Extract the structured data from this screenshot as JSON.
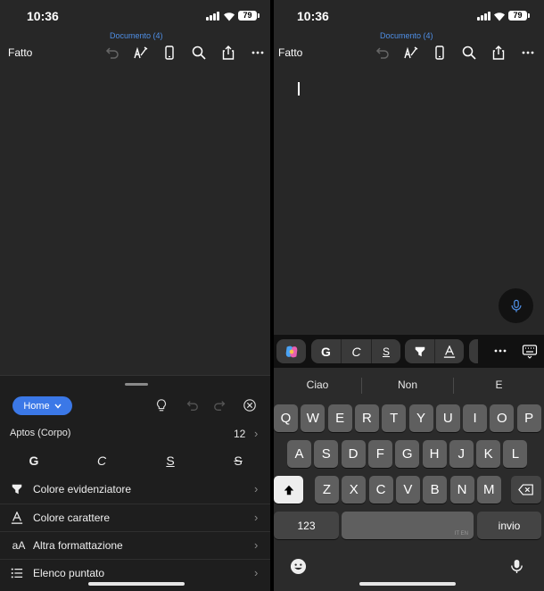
{
  "left": {
    "status": {
      "time": "10:36",
      "battery": "79"
    },
    "doc_title": "Documento (4)",
    "done_label": "Fatto",
    "sheet": {
      "tab_label": "Home",
      "font_name": "Aptos (Corpo)",
      "font_size": "12",
      "format_buttons": [
        "G",
        "C",
        "S",
        "S"
      ],
      "menu_items": [
        {
          "label": "Colore evidenziatore",
          "icon": "highlighter-icon"
        },
        {
          "label": "Colore carattere",
          "icon": "font-color-icon"
        },
        {
          "label": "Altra formattazione",
          "icon": "text-size-icon"
        },
        {
          "label": "Elenco puntato",
          "icon": "bullet-list-icon"
        }
      ]
    }
  },
  "right": {
    "status": {
      "time": "10:36",
      "battery": "79"
    },
    "doc_title": "Documento (4)",
    "done_label": "Fatto",
    "toolbar": {
      "bold": "G",
      "italic": "C",
      "underline": "S"
    },
    "suggestions": [
      "Ciao",
      "Non",
      "E"
    ],
    "keys": {
      "row1": [
        "Q",
        "W",
        "E",
        "R",
        "T",
        "Y",
        "U",
        "I",
        "O",
        "P"
      ],
      "row2": [
        "A",
        "S",
        "D",
        "F",
        "G",
        "H",
        "J",
        "K",
        "L"
      ],
      "row3": [
        "Z",
        "X",
        "C",
        "V",
        "B",
        "N",
        "M"
      ],
      "numbers": "123",
      "return": "invio",
      "space_lang": "IT EN"
    }
  },
  "colors": {
    "accent": "#3b78e7",
    "doc_title": "#4f8fe6",
    "background": "#272727",
    "sheet": "#1e1e1e"
  }
}
